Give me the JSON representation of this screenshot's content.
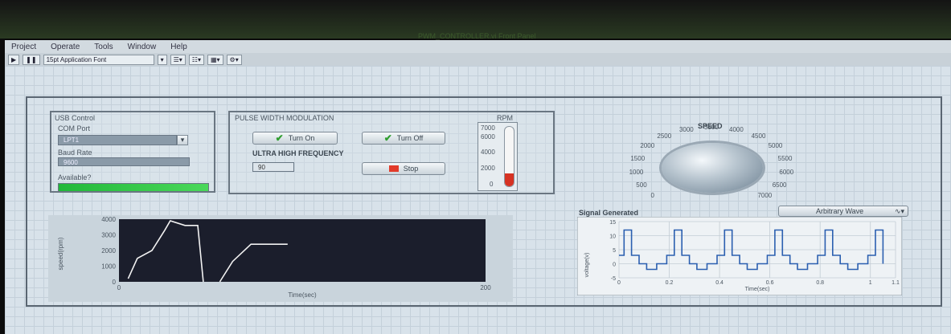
{
  "window": {
    "title": "PWM_CONTROLLER.vi Front Panel"
  },
  "menu": [
    "Project",
    "Operate",
    "Tools",
    "Window",
    "Help"
  ],
  "toolbar": {
    "font_select": "15pt Application Font"
  },
  "usb": {
    "title": "USB Control",
    "com_label": "COM Port",
    "com_value": "LPT1",
    "baud_label": "Baud Rate",
    "baud_value": "9600",
    "available_label": "Available?"
  },
  "pwm": {
    "title": "PULSE  WIDTH  MODULATION",
    "turn_on": "Turn On",
    "turn_off": "Turn Off",
    "uhf_label": "ULTRA HIGH FREQUENCY",
    "uhf_value": "90",
    "stop": "Stop"
  },
  "rpm": {
    "title": "RPM",
    "ticks": [
      "7000",
      "6000",
      "4000",
      "2000",
      "0"
    ],
    "value": 1500,
    "max": 7000
  },
  "speed": {
    "title": "SPEED",
    "scale": [
      "0",
      "500",
      "1000",
      "1500",
      "2000",
      "2500",
      "3000",
      "3500",
      "4000",
      "4500",
      "5000",
      "5500",
      "6000",
      "6500",
      "7000"
    ]
  },
  "waveform": {
    "title": "Signal Generated",
    "selector": "Arbitrary Wave"
  },
  "chart_data": [
    {
      "type": "line",
      "title": "",
      "xlabel": "Time(sec)",
      "ylabel": "speed(rpm)",
      "xlim": [
        0,
        200
      ],
      "ylim": [
        0,
        4000
      ],
      "x_ticks": [
        "0",
        "200"
      ],
      "y_ticks": [
        "4000",
        "3000",
        "2000",
        "1000",
        "0"
      ],
      "series": [
        {
          "points": [
            [
              5,
              200
            ],
            [
              10,
              1500
            ],
            [
              18,
              2000
            ],
            [
              25,
              3300
            ],
            [
              28,
              3900
            ],
            [
              36,
              3600
            ],
            [
              43,
              3600
            ],
            [
              46,
              0
            ]
          ]
        },
        {
          "points": [
            [
              55,
              0
            ],
            [
              62,
              1300
            ],
            [
              72,
              2400
            ],
            [
              92,
              2400
            ]
          ]
        }
      ]
    },
    {
      "type": "line",
      "title": "Signal Generated",
      "xlabel": "Time(sec)",
      "ylabel": "voltage(v)",
      "xlim": [
        0,
        1.1
      ],
      "ylim": [
        -5,
        15
      ],
      "x_ticks": [
        "0",
        "0.2",
        "0.4",
        "0.6",
        "0.8",
        "1",
        "1.1"
      ],
      "y_ticks": [
        "15",
        "10",
        "5",
        "0",
        "-5"
      ],
      "series": [
        {
          "points": [
            [
              0,
              3
            ],
            [
              0.02,
              3
            ],
            [
              0.02,
              12
            ],
            [
              0.05,
              12
            ],
            [
              0.05,
              3
            ],
            [
              0.08,
              3
            ],
            [
              0.08,
              0
            ],
            [
              0.11,
              0
            ],
            [
              0.11,
              -2
            ],
            [
              0.15,
              -2
            ],
            [
              0.15,
              0
            ],
            [
              0.19,
              0
            ],
            [
              0.19,
              3
            ],
            [
              0.22,
              3
            ],
            [
              0.22,
              12
            ],
            [
              0.25,
              12
            ],
            [
              0.25,
              3
            ],
            [
              0.28,
              3
            ],
            [
              0.28,
              0
            ],
            [
              0.31,
              0
            ],
            [
              0.31,
              -2
            ],
            [
              0.35,
              -2
            ],
            [
              0.35,
              0
            ],
            [
              0.39,
              0
            ],
            [
              0.39,
              3
            ],
            [
              0.42,
              3
            ],
            [
              0.42,
              12
            ],
            [
              0.45,
              12
            ],
            [
              0.45,
              3
            ],
            [
              0.48,
              3
            ],
            [
              0.48,
              0
            ],
            [
              0.51,
              0
            ],
            [
              0.51,
              -2
            ],
            [
              0.55,
              -2
            ],
            [
              0.55,
              0
            ],
            [
              0.59,
              0
            ],
            [
              0.59,
              3
            ],
            [
              0.62,
              3
            ],
            [
              0.62,
              12
            ],
            [
              0.65,
              12
            ],
            [
              0.65,
              3
            ],
            [
              0.68,
              3
            ],
            [
              0.68,
              0
            ],
            [
              0.71,
              0
            ],
            [
              0.71,
              -2
            ],
            [
              0.75,
              -2
            ],
            [
              0.75,
              0
            ],
            [
              0.79,
              0
            ],
            [
              0.79,
              3
            ],
            [
              0.82,
              3
            ],
            [
              0.82,
              12
            ],
            [
              0.85,
              12
            ],
            [
              0.85,
              3
            ],
            [
              0.88,
              3
            ],
            [
              0.88,
              0
            ],
            [
              0.91,
              0
            ],
            [
              0.91,
              -2
            ],
            [
              0.95,
              -2
            ],
            [
              0.95,
              0
            ],
            [
              0.99,
              0
            ],
            [
              0.99,
              3
            ],
            [
              1.02,
              3
            ],
            [
              1.02,
              12
            ],
            [
              1.05,
              12
            ],
            [
              1.05,
              0
            ]
          ]
        }
      ]
    }
  ]
}
